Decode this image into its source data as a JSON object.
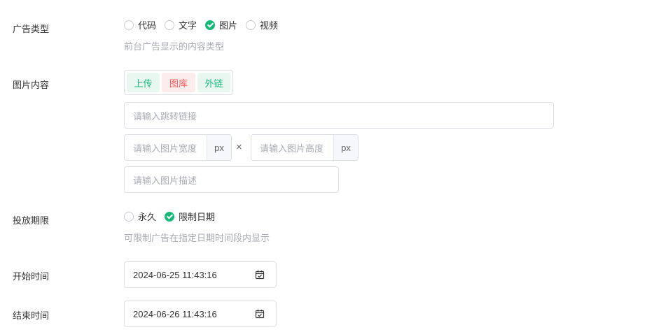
{
  "ad_type": {
    "label": "广告类型",
    "options": [
      "代码",
      "文字",
      "图片",
      "视频"
    ],
    "selected": "图片",
    "help": "前台广告显示的内容类型"
  },
  "image_content": {
    "label": "图片内容",
    "tabs": [
      "上传",
      "图库",
      "外链"
    ],
    "link_placeholder": "请输入跳转链接",
    "width_placeholder": "请输入图片宽度",
    "height_placeholder": "请输入图片高度",
    "unit": "px",
    "times": "×",
    "desc_placeholder": "请输入图片描述"
  },
  "period": {
    "label": "投放期限",
    "options": [
      "永久",
      "限制日期"
    ],
    "selected": "限制日期",
    "help": "可限制广告在指定日期时间段内显示"
  },
  "start_time": {
    "label": "开始时间",
    "value": "2024-06-25 11:43:16"
  },
  "end_time": {
    "label": "结束时间",
    "value": "2024-06-26 11:43:16"
  },
  "colors": {
    "accent": "#19b87a",
    "danger": "#f25c5c"
  }
}
